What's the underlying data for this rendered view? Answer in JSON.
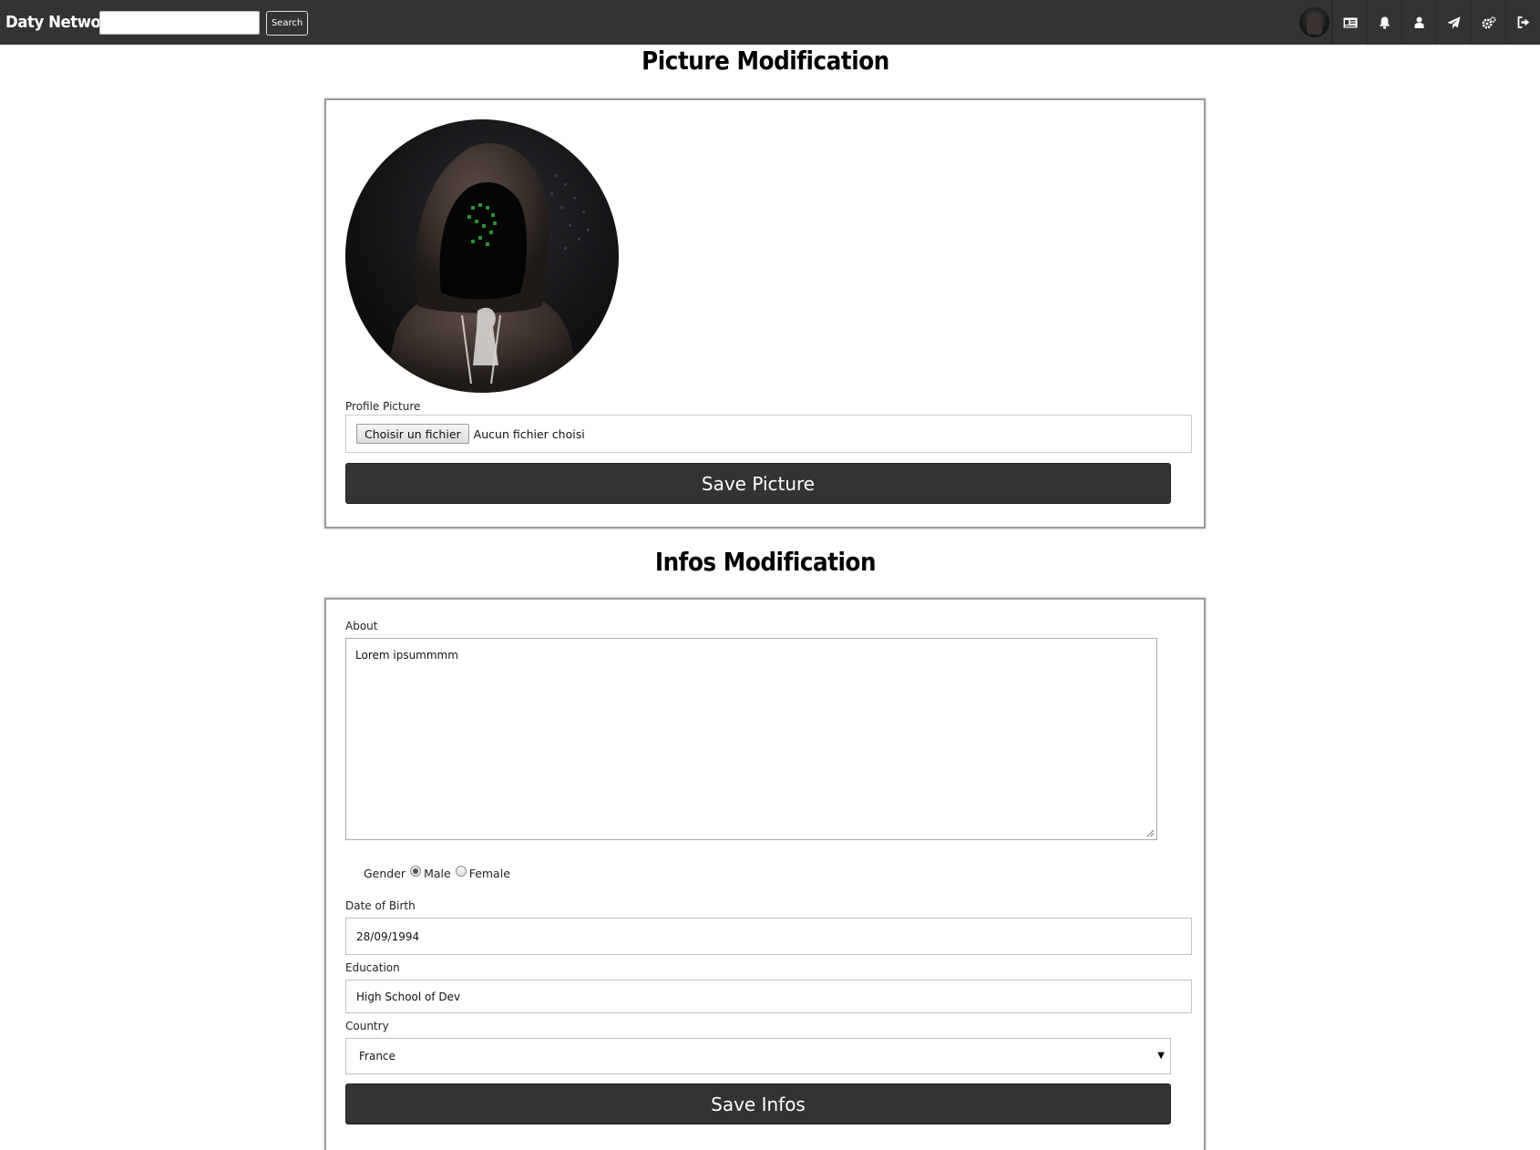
{
  "navbar": {
    "brand": "Daty Network",
    "search_placeholder": "",
    "search_button": "Search",
    "icons": [
      "avatar",
      "id-card-icon",
      "bell-icon",
      "user-icon",
      "paper-plane-icon",
      "cogs-icon",
      "sign-out-icon"
    ]
  },
  "picture_section": {
    "title": "Picture Modification",
    "profile_picture_label": "Profile Picture",
    "file_button": "Choisir un fichier",
    "file_status": "Aucun fichier choisi",
    "save_button": "Save Picture"
  },
  "infos_section": {
    "title": "Infos Modification",
    "about_label": "About",
    "about_value": "Lorem ipsummmm",
    "gender_label": "Gender",
    "gender_options": [
      "Male",
      "Female"
    ],
    "gender_selected": "Male",
    "dob_label": "Date of Birth",
    "dob_value": "28/09/1994",
    "education_label": "Education",
    "education_value": "High School of Dev",
    "country_label": "Country",
    "country_value": "France",
    "save_button": "Save Infos"
  },
  "colors": {
    "navbar_bg": "#333333",
    "button_bg": "#333333",
    "panel_border": "#9a9a9a"
  }
}
